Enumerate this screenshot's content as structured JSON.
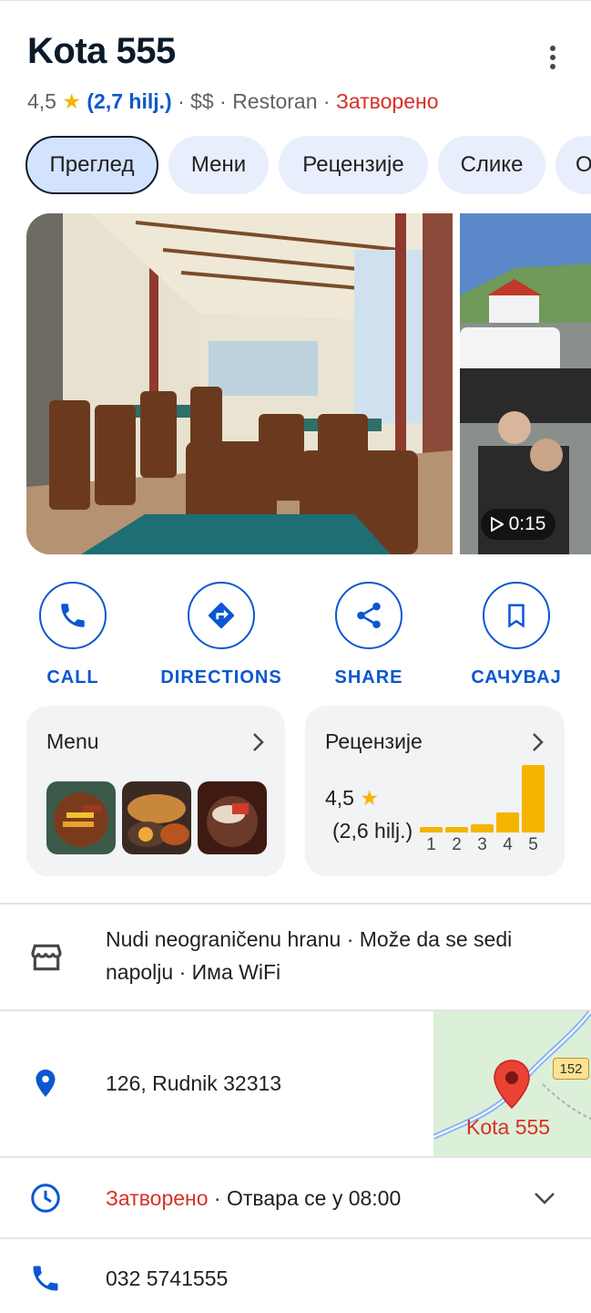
{
  "place": {
    "name": "Kota 555",
    "rating": "4,5",
    "reviews_link": "(2,7 hilj.)",
    "price": "$$",
    "category": "Restoran",
    "status": "Затворено",
    "sep": " · "
  },
  "tabs": [
    {
      "label": "Преглед",
      "active": true
    },
    {
      "label": "Мени"
    },
    {
      "label": "Рецензије"
    },
    {
      "label": "Слике"
    },
    {
      "label": "О"
    }
  ],
  "photos": {
    "video_duration": "0:15"
  },
  "actions": [
    {
      "label": "CALL",
      "icon": "phone-icon"
    },
    {
      "label": "DIRECTIONS",
      "icon": "directions-icon"
    },
    {
      "label": "SHARE",
      "icon": "share-icon"
    },
    {
      "label": "САЧУВАЈ",
      "icon": "bookmark-icon"
    }
  ],
  "menu_card": {
    "title": "Menu"
  },
  "reviews_card": {
    "title": "Рецензије",
    "rating": "4,5",
    "count": "(2,6 hilj.)",
    "distribution": [
      {
        "star": "1",
        "share": 0.06
      },
      {
        "star": "2",
        "share": 0.06
      },
      {
        "star": "3",
        "share": 0.1
      },
      {
        "star": "4",
        "share": 0.24
      },
      {
        "star": "5",
        "share": 0.8
      }
    ]
  },
  "info": {
    "amenities_line1": "Nudi neograničenu hranu · Može da se sedi",
    "amenities_line2": "napolju · Има WiFi",
    "address": "126, Rudnik 32313",
    "map_label": "Kota 555",
    "map_road": "152",
    "hours_status": "Затворено",
    "hours_rest": " · Отвара се у 08:00",
    "phone": "032 5741555"
  },
  "colors": {
    "accent": "#0b57d0",
    "closed": "#d93025",
    "star": "#f4b400",
    "chip": "#e8eefb"
  }
}
